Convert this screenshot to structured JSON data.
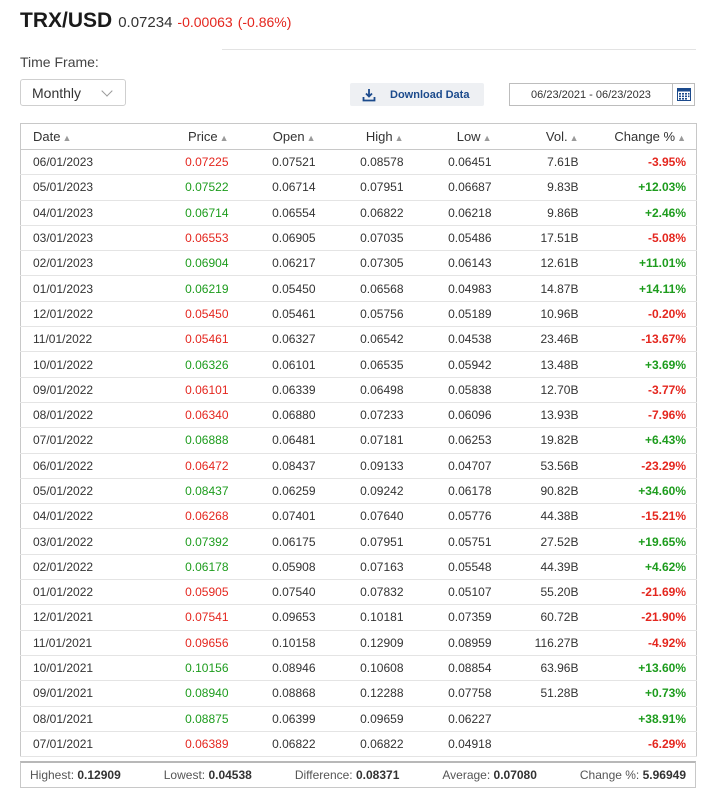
{
  "header": {
    "pair": "TRX/USD",
    "last": "0.07234",
    "change": "-0.00063",
    "change_pct": "(-0.86%)"
  },
  "colors": {
    "up": "#1d9c1d",
    "down": "#e4261e",
    "link": "#1b4a8c"
  },
  "timeframe": {
    "label": "Time Frame:",
    "value": "Monthly"
  },
  "download": {
    "label": "Download Data",
    "icon": "download-icon"
  },
  "date_range": {
    "value": "06/23/2021 - 06/23/2023",
    "icon": "calendar-icon"
  },
  "table": {
    "columns": [
      "Date",
      "Price",
      "Open",
      "High",
      "Low",
      "Vol.",
      "Change %"
    ],
    "rows": [
      {
        "date": "06/01/2023",
        "price": "0.07225",
        "open": "0.07521",
        "high": "0.08578",
        "low": "0.06451",
        "vol": "7.61B",
        "chg": "-3.95%",
        "dir": "dn"
      },
      {
        "date": "05/01/2023",
        "price": "0.07522",
        "open": "0.06714",
        "high": "0.07951",
        "low": "0.06687",
        "vol": "9.83B",
        "chg": "+12.03%",
        "dir": "up"
      },
      {
        "date": "04/01/2023",
        "price": "0.06714",
        "open": "0.06554",
        "high": "0.06822",
        "low": "0.06218",
        "vol": "9.86B",
        "chg": "+2.46%",
        "dir": "up"
      },
      {
        "date": "03/01/2023",
        "price": "0.06553",
        "open": "0.06905",
        "high": "0.07035",
        "low": "0.05486",
        "vol": "17.51B",
        "chg": "-5.08%",
        "dir": "dn"
      },
      {
        "date": "02/01/2023",
        "price": "0.06904",
        "open": "0.06217",
        "high": "0.07305",
        "low": "0.06143",
        "vol": "12.61B",
        "chg": "+11.01%",
        "dir": "up"
      },
      {
        "date": "01/01/2023",
        "price": "0.06219",
        "open": "0.05450",
        "high": "0.06568",
        "low": "0.04983",
        "vol": "14.87B",
        "chg": "+14.11%",
        "dir": "up"
      },
      {
        "date": "12/01/2022",
        "price": "0.05450",
        "open": "0.05461",
        "high": "0.05756",
        "low": "0.05189",
        "vol": "10.96B",
        "chg": "-0.20%",
        "dir": "dn"
      },
      {
        "date": "11/01/2022",
        "price": "0.05461",
        "open": "0.06327",
        "high": "0.06542",
        "low": "0.04538",
        "vol": "23.46B",
        "chg": "-13.67%",
        "dir": "dn"
      },
      {
        "date": "10/01/2022",
        "price": "0.06326",
        "open": "0.06101",
        "high": "0.06535",
        "low": "0.05942",
        "vol": "13.48B",
        "chg": "+3.69%",
        "dir": "up"
      },
      {
        "date": "09/01/2022",
        "price": "0.06101",
        "open": "0.06339",
        "high": "0.06498",
        "low": "0.05838",
        "vol": "12.70B",
        "chg": "-3.77%",
        "dir": "dn"
      },
      {
        "date": "08/01/2022",
        "price": "0.06340",
        "open": "0.06880",
        "high": "0.07233",
        "low": "0.06096",
        "vol": "13.93B",
        "chg": "-7.96%",
        "dir": "dn"
      },
      {
        "date": "07/01/2022",
        "price": "0.06888",
        "open": "0.06481",
        "high": "0.07181",
        "low": "0.06253",
        "vol": "19.82B",
        "chg": "+6.43%",
        "dir": "up"
      },
      {
        "date": "06/01/2022",
        "price": "0.06472",
        "open": "0.08437",
        "high": "0.09133",
        "low": "0.04707",
        "vol": "53.56B",
        "chg": "-23.29%",
        "dir": "dn"
      },
      {
        "date": "05/01/2022",
        "price": "0.08437",
        "open": "0.06259",
        "high": "0.09242",
        "low": "0.06178",
        "vol": "90.82B",
        "chg": "+34.60%",
        "dir": "up"
      },
      {
        "date": "04/01/2022",
        "price": "0.06268",
        "open": "0.07401",
        "high": "0.07640",
        "low": "0.05776",
        "vol": "44.38B",
        "chg": "-15.21%",
        "dir": "dn"
      },
      {
        "date": "03/01/2022",
        "price": "0.07392",
        "open": "0.06175",
        "high": "0.07951",
        "low": "0.05751",
        "vol": "27.52B",
        "chg": "+19.65%",
        "dir": "up"
      },
      {
        "date": "02/01/2022",
        "price": "0.06178",
        "open": "0.05908",
        "high": "0.07163",
        "low": "0.05548",
        "vol": "44.39B",
        "chg": "+4.62%",
        "dir": "up"
      },
      {
        "date": "01/01/2022",
        "price": "0.05905",
        "open": "0.07540",
        "high": "0.07832",
        "low": "0.05107",
        "vol": "55.20B",
        "chg": "-21.69%",
        "dir": "dn"
      },
      {
        "date": "12/01/2021",
        "price": "0.07541",
        "open": "0.09653",
        "high": "0.10181",
        "low": "0.07359",
        "vol": "60.72B",
        "chg": "-21.90%",
        "dir": "dn"
      },
      {
        "date": "11/01/2021",
        "price": "0.09656",
        "open": "0.10158",
        "high": "0.12909",
        "low": "0.08959",
        "vol": "116.27B",
        "chg": "-4.92%",
        "dir": "dn"
      },
      {
        "date": "10/01/2021",
        "price": "0.10156",
        "open": "0.08946",
        "high": "0.10608",
        "low": "0.08854",
        "vol": "63.96B",
        "chg": "+13.60%",
        "dir": "up"
      },
      {
        "date": "09/01/2021",
        "price": "0.08940",
        "open": "0.08868",
        "high": "0.12288",
        "low": "0.07758",
        "vol": "51.28B",
        "chg": "+0.73%",
        "dir": "up"
      },
      {
        "date": "08/01/2021",
        "price": "0.08875",
        "open": "0.06399",
        "high": "0.09659",
        "low": "0.06227",
        "vol": "",
        "chg": "+38.91%",
        "dir": "up"
      },
      {
        "date": "07/01/2021",
        "price": "0.06389",
        "open": "0.06822",
        "high": "0.06822",
        "low": "0.04918",
        "vol": "",
        "chg": "-6.29%",
        "dir": "dn"
      }
    ]
  },
  "summary": {
    "highest_label": "Highest:",
    "highest": "0.12909",
    "lowest_label": "Lowest:",
    "lowest": "0.04538",
    "difference_label": "Difference:",
    "difference": "0.08371",
    "average_label": "Average:",
    "average": "0.07080",
    "change_label": "Change %:",
    "change": "5.96949"
  }
}
